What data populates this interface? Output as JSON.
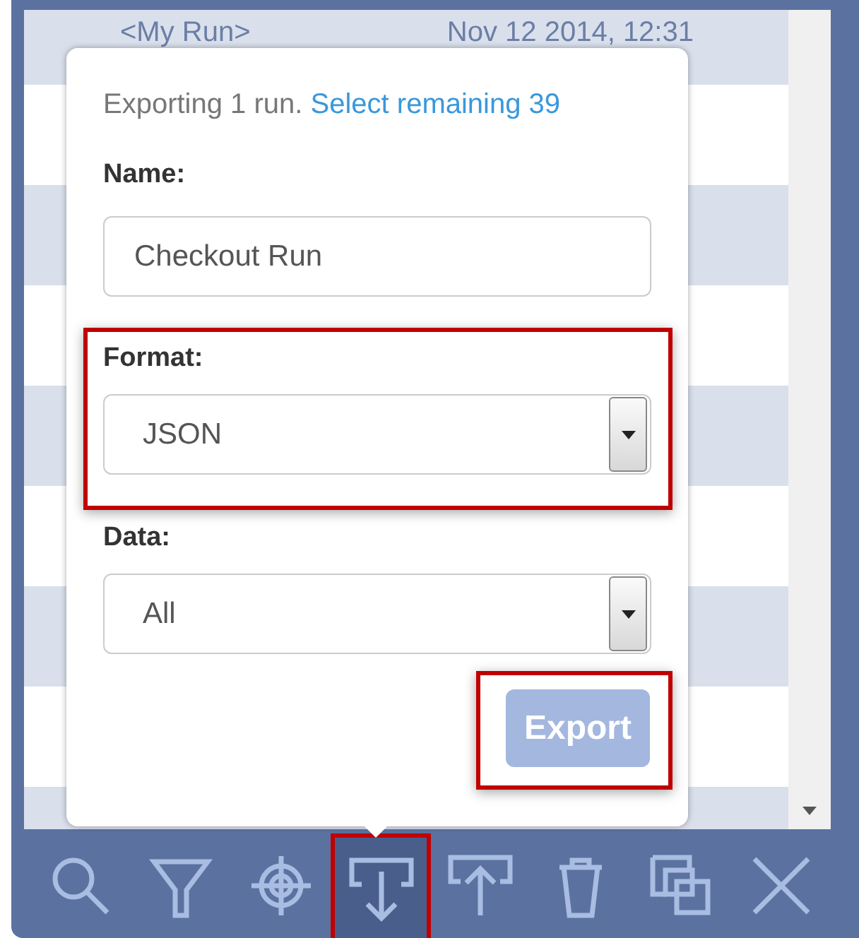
{
  "list": {
    "rows": [
      {
        "name": "<My Run>",
        "date": "Nov 12 2014, 12:31"
      }
    ]
  },
  "export_popup": {
    "message": "Exporting 1 run.",
    "link": "Select remaining 39",
    "fields": [
      {
        "kind": "text",
        "label": "Name:",
        "value": "Checkout Run",
        "highlighted": false
      },
      {
        "kind": "select",
        "label": "Format:",
        "value": "JSON",
        "highlighted": true
      },
      {
        "kind": "select",
        "label": "Data:",
        "value": "All",
        "highlighted": false
      }
    ],
    "button": {
      "label": "Export",
      "disabled": true,
      "highlighted": true
    }
  },
  "toolbar": [
    {
      "kind": "search",
      "selected": false,
      "highlighted": false
    },
    {
      "kind": "filter",
      "selected": false,
      "highlighted": false
    },
    {
      "kind": "target",
      "selected": false,
      "highlighted": false
    },
    {
      "kind": "export",
      "selected": true,
      "highlighted": true
    },
    {
      "kind": "import",
      "selected": false,
      "highlighted": false
    },
    {
      "kind": "trash",
      "selected": false,
      "highlighted": false
    },
    {
      "kind": "copy",
      "selected": false,
      "highlighted": false
    },
    {
      "kind": "close",
      "selected": false,
      "highlighted": false
    }
  ]
}
